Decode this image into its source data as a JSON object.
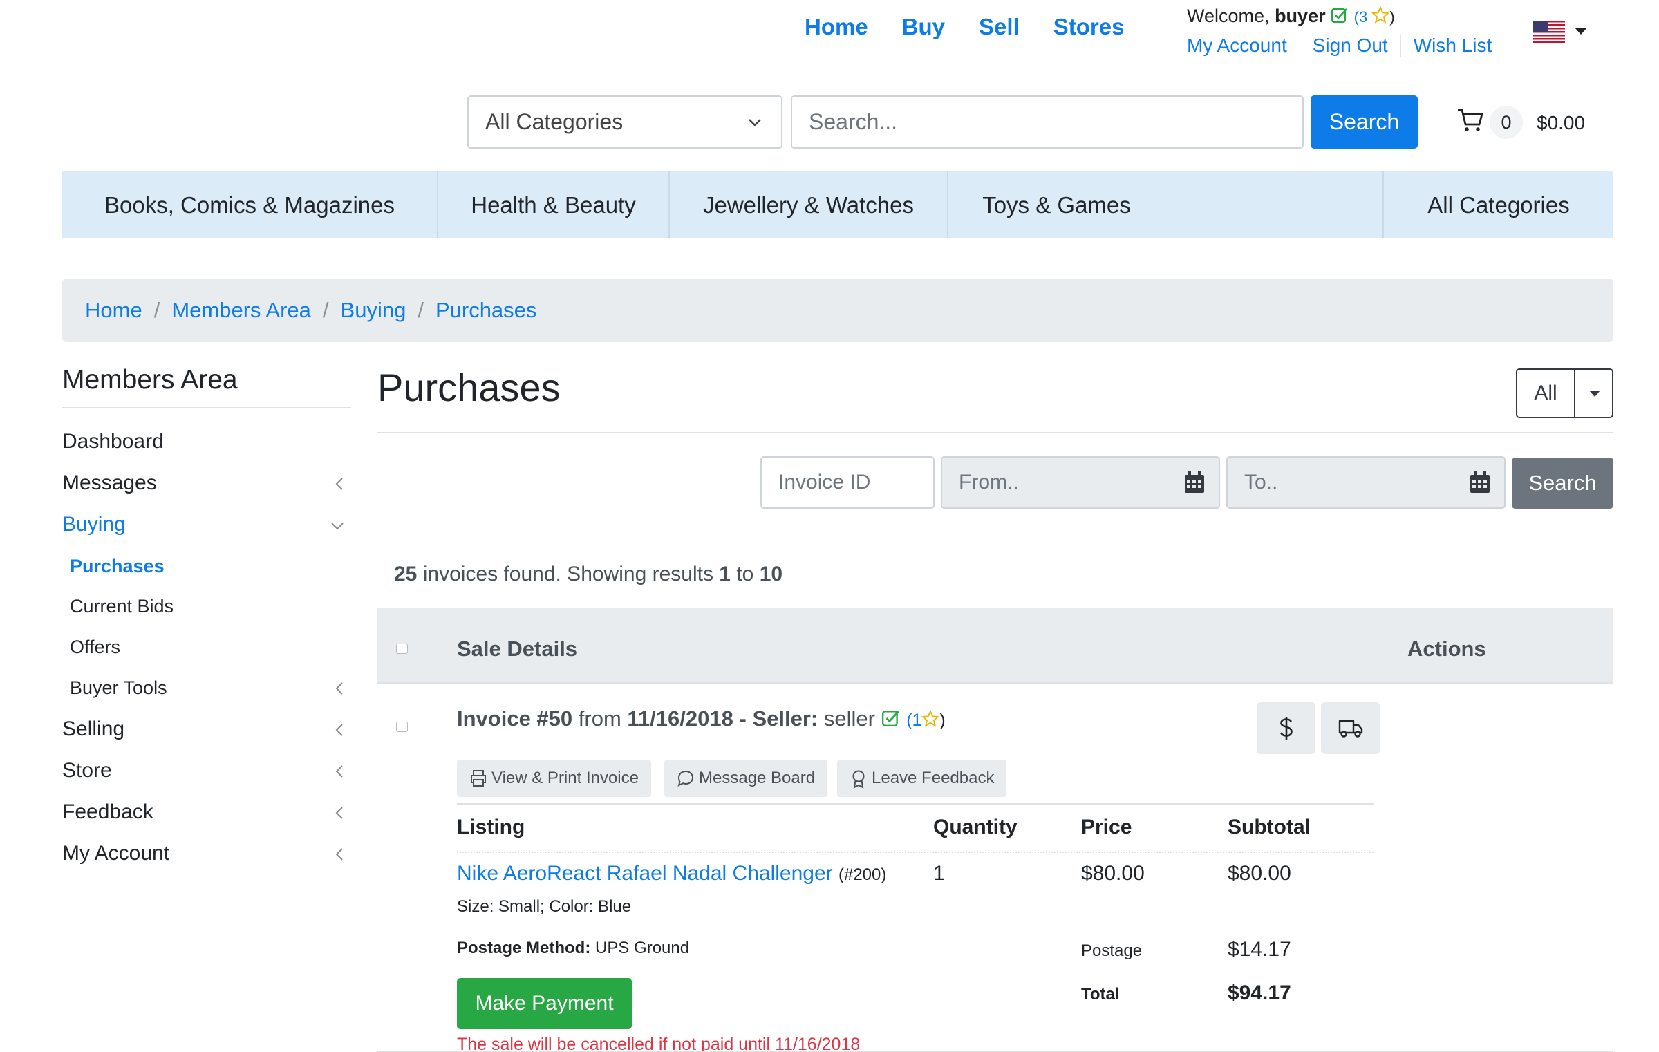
{
  "topnav": {
    "items": [
      "Home",
      "Buy",
      "Sell",
      "Stores"
    ]
  },
  "user": {
    "welcome": "Welcome,",
    "name": "buyer",
    "rating_open": "(3",
    "rating_close": ")",
    "links": [
      "My Account",
      "Sign Out",
      "Wish List"
    ]
  },
  "search": {
    "category": "All Categories",
    "placeholder": "Search...",
    "button": "Search"
  },
  "cart": {
    "count": "0",
    "total": "$0.00"
  },
  "categories": [
    "Books, Comics & Magazines",
    "Health & Beauty",
    "Jewellery & Watches",
    "Toys & Games",
    "All Categories"
  ],
  "breadcrumb": [
    "Home",
    "Members Area",
    "Buying",
    "Purchases"
  ],
  "sidebar": {
    "title": "Members Area",
    "items": {
      "dashboard": "Dashboard",
      "messages": "Messages",
      "buying": "Buying",
      "purchases": "Purchases",
      "current_bids": "Current Bids",
      "offers": "Offers",
      "buyer_tools": "Buyer Tools",
      "selling": "Selling",
      "store": "Store",
      "feedback": "Feedback",
      "my_account": "My Account"
    }
  },
  "main": {
    "title": "Purchases",
    "filter_dropdown": "All",
    "filters": {
      "invoice_placeholder": "Invoice ID",
      "from_placeholder": "From..",
      "to_placeholder": "To..",
      "button": "Search"
    },
    "results": {
      "total": "25",
      "text1": "invoices found. Showing results",
      "from": "1",
      "to_word": "to",
      "to": "10"
    },
    "table_headers": {
      "details": "Sale Details",
      "actions": "Actions"
    }
  },
  "invoice": {
    "label": "Invoice #50",
    "from_word": "from",
    "date": "11/16/2018",
    "dash": "-",
    "seller_label": "Seller:",
    "seller_name": "seller",
    "seller_rating_open": "(1",
    "seller_rating_close": ")",
    "actions": [
      "View & Print Invoice",
      "Message Board",
      "Leave Feedback"
    ],
    "columns": [
      "Listing",
      "Quantity",
      "Price",
      "Subtotal"
    ],
    "item": {
      "name": "Nike AeroReact Rafael Nadal Challenger",
      "id": "(#200)",
      "attributes": "Size: Small; Color: Blue",
      "quantity": "1",
      "price": "$80.00",
      "subtotal": "$80.00"
    },
    "postage_method_label": "Postage Method:",
    "postage_method": "UPS Ground",
    "postage_label": "Postage",
    "postage_value": "$14.17",
    "total_label": "Total",
    "total_value": "$94.17",
    "pay_button": "Make Payment",
    "warning": "The sale will be cancelled if not paid until 11/16/2018"
  },
  "colors": {
    "link": "#0d7ce8",
    "category_bar": "#dcebf8",
    "success": "#28a745",
    "danger": "#dc3545",
    "secondary": "#6c757d"
  }
}
